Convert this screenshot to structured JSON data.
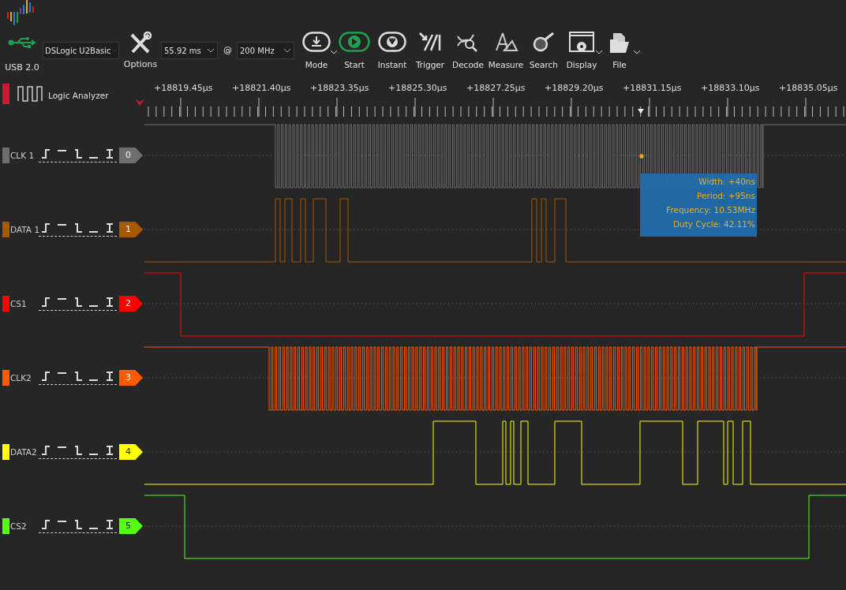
{
  "device": {
    "connection": "USB 2.0",
    "model": "DSLogic U2Basic"
  },
  "toolbar": {
    "options_label": "Options",
    "duration": "55.92 ms",
    "at_sign": "@",
    "sample_rate": "200 MHz",
    "buttons": [
      {
        "kind": "mode",
        "label": "Mode",
        "has_menu": true
      },
      {
        "kind": "start",
        "label": "Start",
        "has_menu": false
      },
      {
        "kind": "instant",
        "label": "Instant",
        "has_menu": false
      },
      {
        "kind": "trigger",
        "label": "Trigger",
        "has_menu": false
      },
      {
        "kind": "decode",
        "label": "Decode",
        "has_menu": false
      },
      {
        "kind": "measure",
        "label": "Measure",
        "has_menu": false
      },
      {
        "kind": "search",
        "label": "Search",
        "has_menu": false
      },
      {
        "kind": "display",
        "label": "Display",
        "has_menu": true
      },
      {
        "kind": "file",
        "label": "File",
        "has_menu": true
      }
    ]
  },
  "session": {
    "title": "Logic Analyzer"
  },
  "ruler": {
    "labels": [
      "+18819.45µs",
      "+18821.40µs",
      "+18823.35µs",
      "+18825.30µs",
      "+18827.25µs",
      "+18829.20µs",
      "+18831.15µs",
      "+18833.10µs",
      "+18835.05µs"
    ]
  },
  "channels": [
    {
      "name": "CLK 1",
      "number": "0",
      "color": "#6e6e6e"
    },
    {
      "name": "DATA 1",
      "number": "1",
      "color": "#a85800"
    },
    {
      "name": "CS1",
      "number": "2",
      "color": "#ff0000"
    },
    {
      "name": "CLK2",
      "number": "3",
      "color": "#ff5a00"
    },
    {
      "name": "DATA2",
      "number": "4",
      "color": "#ffff00"
    },
    {
      "name": "CS2",
      "number": "5",
      "color": "#55ff11"
    }
  ],
  "measure_tooltip": [
    "Width: +40ns",
    "Period: +95ns",
    "Frequency: 10.53MHz",
    "Duty Cycle: 42.11%"
  ]
}
